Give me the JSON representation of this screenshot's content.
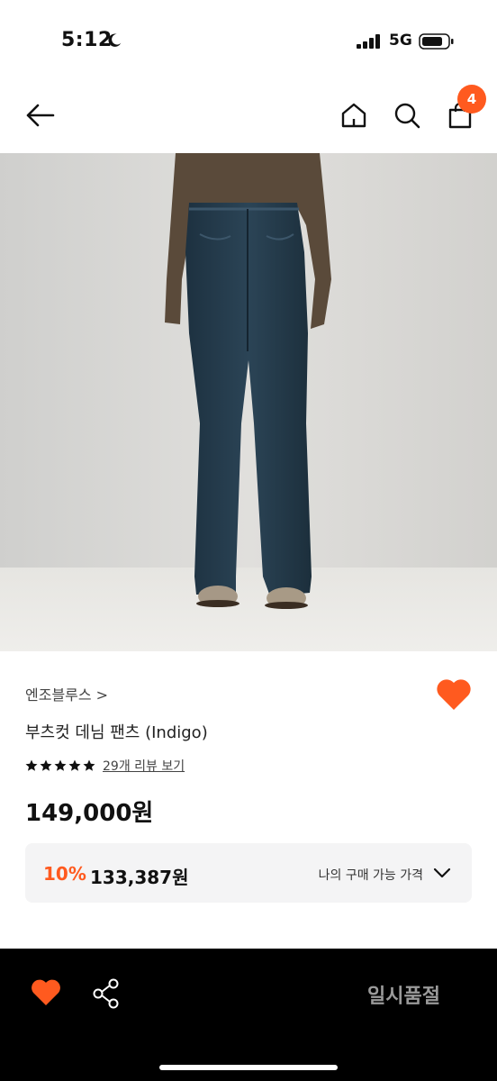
{
  "status_bar": {
    "time": "5:12",
    "network": "5G"
  },
  "header": {
    "cart_count": "4",
    "icons": [
      "back-arrow-icon",
      "home-icon",
      "search-icon",
      "shopping-bag-icon"
    ]
  },
  "product": {
    "brand": "엔조블루스 >",
    "name": "부츠컷 데님 팬츠 (Indigo)",
    "rating_stars": 5,
    "review_link": "29개 리뷰 보기",
    "price": "149,000원",
    "wishlisted": true
  },
  "discount": {
    "rate": "10%",
    "price": "133,387원",
    "label": "나의 구매 가능 가격"
  },
  "bottom_bar": {
    "cta": "일시품절"
  },
  "colors": {
    "accent": "#ff5a1f",
    "bottom_bar_bg": "#000000",
    "discount_bg": "#f4f4f5"
  }
}
